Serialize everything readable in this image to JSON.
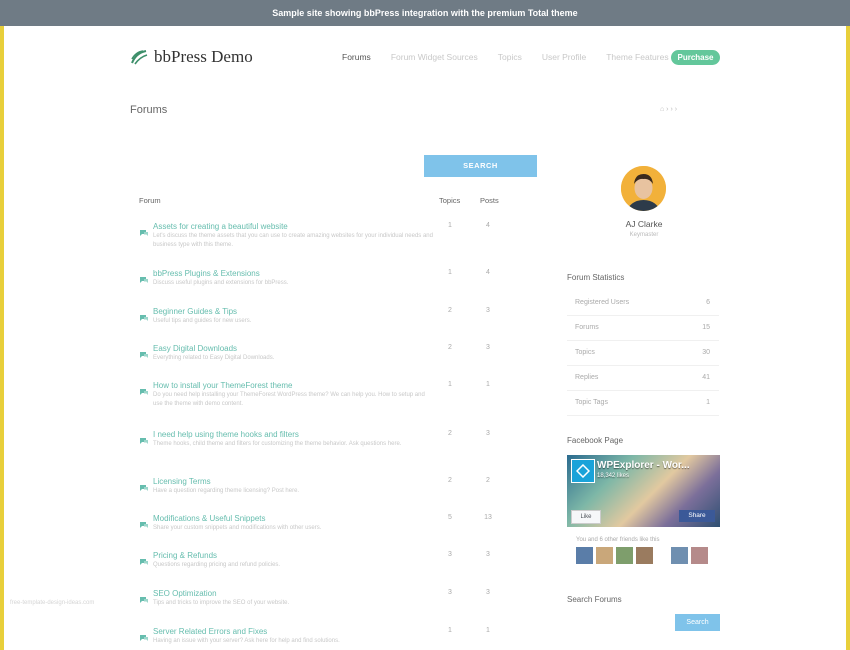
{
  "banner": {
    "text": "Sample site showing bbPress integration with the premium Total theme"
  },
  "header": {
    "logo_text": "bbPress Demo",
    "nav": [
      {
        "label": "Forums",
        "state": "active"
      },
      {
        "label": "Forum Widget Sources",
        "state": "faded"
      },
      {
        "label": "Topics",
        "state": "faded"
      },
      {
        "label": "User Profile",
        "state": "faded"
      },
      {
        "label": "Theme Features",
        "state": "faded"
      }
    ],
    "purchase_label": "Purchase"
  },
  "page": {
    "title": "Forums",
    "breadcrumb": "⌂ › › ›"
  },
  "forum_search": {
    "button_label": "SEARCH"
  },
  "forum_table": {
    "headers": {
      "forum": "Forum",
      "topics": "Topics",
      "posts": "Posts"
    },
    "rows": [
      {
        "title": "Assets for creating a beautiful website",
        "desc": "Let's discuss the theme assets that you can use to create amazing websites for your individual needs and business type with this theme.",
        "topics": "1",
        "posts": "4"
      },
      {
        "title": "bbPress Plugins & Extensions",
        "desc": "Discuss useful plugins and extensions for bbPress.",
        "topics": "1",
        "posts": "4"
      },
      {
        "title": "Beginner Guides & Tips",
        "desc": "Useful tips and guides for new users.",
        "topics": "2",
        "posts": "3"
      },
      {
        "title": "Easy Digital Downloads",
        "desc": "Everything related to Easy Digital Downloads.",
        "topics": "2",
        "posts": "3"
      },
      {
        "title": "How to install your ThemeForest theme",
        "desc": "Do you need help installing your ThemeForest WordPress theme? We can help you. How to setup and use the theme with demo content.",
        "topics": "1",
        "posts": "1"
      },
      {
        "title": "I need help using theme hooks and filters",
        "desc": "Theme hooks, child theme and filters for customizing the theme behavior. Ask questions here.",
        "topics": "2",
        "posts": "3"
      },
      {
        "title": "Licensing Terms",
        "desc": "Have a question regarding theme licensing? Post here.",
        "topics": "2",
        "posts": "2"
      },
      {
        "title": "Modifications & Useful Snippets",
        "desc": "Share your custom snippets and modifications with other users.",
        "topics": "5",
        "posts": "13"
      },
      {
        "title": "Pricing & Refunds",
        "desc": "Questions regarding pricing and refund policies.",
        "topics": "3",
        "posts": "3"
      },
      {
        "title": "SEO Optimization",
        "desc": "Tips and tricks to improve the SEO of your website.",
        "topics": "3",
        "posts": "3"
      },
      {
        "title": "Server Related Errors and Fixes",
        "desc": "Having an issue with your server? Ask here for help and find solutions.",
        "topics": "1",
        "posts": "1"
      }
    ]
  },
  "sidebar": {
    "profile": {
      "name": "AJ Clarke",
      "subtitle": "Keymaster"
    },
    "stats_title": "Forum Statistics",
    "stats": [
      {
        "label": "Registered Users",
        "value": "6"
      },
      {
        "label": "Forums",
        "value": "15"
      },
      {
        "label": "Topics",
        "value": "30"
      },
      {
        "label": "Replies",
        "value": "41"
      },
      {
        "label": "Topic Tags",
        "value": "1"
      }
    ],
    "facebook": {
      "title": "Facebook Page",
      "page_name": "WPExplorer - Wor...",
      "likes": "18,342 likes",
      "like_label": "Like",
      "share_label": "Share",
      "friends_text": "You and 6 other friends like this",
      "colors": [
        "#5a7da8",
        "#c9a77a",
        "#7e9e6c",
        "#9a7b5f",
        "#6f8fb0",
        "#b58a8a"
      ]
    },
    "search_title": "Search Forums",
    "search_label": "Search"
  },
  "footer": {
    "watermark": "free-template-design-ideas.com"
  },
  "colors": {
    "accent": "#7fc3ea",
    "forum_title": "#66bdae",
    "purchase": "#63c79b",
    "banner": "#6f7b85",
    "frame": "#e8cf3a"
  }
}
